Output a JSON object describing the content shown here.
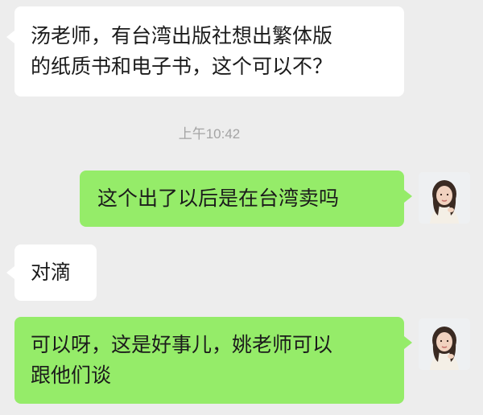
{
  "chat": {
    "messages": [
      {
        "side": "incoming",
        "text": "汤老师，有台湾出版社想出繁体版\n的纸质书和电子书，这个可以不？"
      },
      {
        "side": "outgoing",
        "text": "这个出了以后是在台湾卖吗"
      },
      {
        "side": "incoming",
        "text": "对滴"
      },
      {
        "side": "outgoing",
        "text": "可以呀，这是好事儿，姚老师可以\n跟他们谈"
      }
    ],
    "timestamp": "上午10:42"
  },
  "avatar": {
    "icon": "user-avatar-photo"
  },
  "colors": {
    "background": "#ededed",
    "incoming_bubble": "#ffffff",
    "outgoing_bubble": "#95ec69",
    "timestamp_text": "#a4a4a4",
    "message_text": "#1b1b1b"
  }
}
